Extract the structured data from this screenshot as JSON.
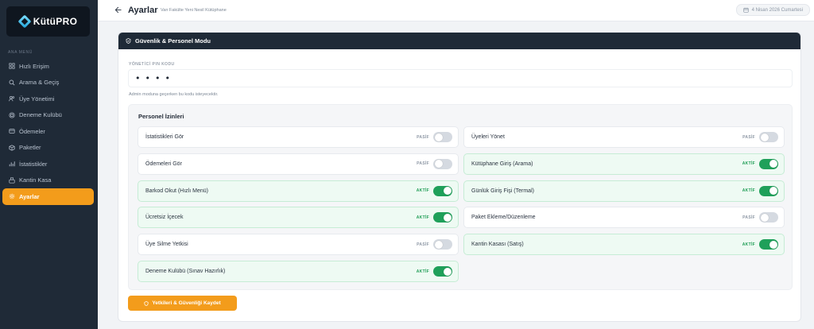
{
  "app": {
    "logo_text": "KütüPRO"
  },
  "sidebar": {
    "caption": "ANA MENÜ",
    "items": [
      {
        "label": "Hızlı Erişim",
        "icon": "grid-icon",
        "active": false
      },
      {
        "label": "Arama & Geçiş",
        "icon": "search-icon",
        "active": false
      },
      {
        "label": "Üye Yönetimi",
        "icon": "users-icon",
        "active": false
      },
      {
        "label": "Deneme Kulübü",
        "icon": "target-icon",
        "active": false
      },
      {
        "label": "Ödemeler",
        "icon": "wallet-icon",
        "active": false
      },
      {
        "label": "Paketler",
        "icon": "box-icon",
        "active": false
      },
      {
        "label": "İstatistikler",
        "icon": "chart-icon",
        "active": false
      },
      {
        "label": "Kantin Kasa",
        "icon": "register-icon",
        "active": false
      },
      {
        "label": "Ayarlar",
        "icon": "gear-icon",
        "active": true
      }
    ]
  },
  "header": {
    "title": "Ayarlar",
    "subtitle": "Van Fakülte Yeni Nesil Kütüphane",
    "date": "4 Nisan 2026 Cumartesi"
  },
  "card": {
    "title": "Güvenlik & Personel Modu",
    "pin_label": "YÖNETİCİ PIN KODU",
    "pin_value": "••••",
    "pin_hint": "Admin moduna geçerken bu kodu isteyecektir."
  },
  "permissions": {
    "title": "Personel İzinleri",
    "active_label": "AKTİF",
    "passive_label": "PASİF",
    "items": [
      {
        "label": "İstatistikleri Gör",
        "enabled": false
      },
      {
        "label": "Üyeleri Yönet",
        "enabled": false
      },
      {
        "label": "Ödemeleri Gör",
        "enabled": false
      },
      {
        "label": "Kütüphane Giriş (Arama)",
        "enabled": true
      },
      {
        "label": "Barkod Okut (Hızlı Menü)",
        "enabled": true
      },
      {
        "label": "Günlük Giriş Fişi (Termal)",
        "enabled": true
      },
      {
        "label": "Ücretsiz İçecek",
        "enabled": true
      },
      {
        "label": "Paket Ekleme/Düzenleme",
        "enabled": false
      },
      {
        "label": "Üye Silme Yetkisi",
        "enabled": false
      },
      {
        "label": "Kantin Kasası (Satış)",
        "enabled": true
      },
      {
        "label": "Deneme Kulübü (Sınav Hazırlık)",
        "enabled": true
      }
    ]
  },
  "actions": {
    "save_label": "Yetkileri & Güvenliği Kaydet"
  },
  "colors": {
    "accent": "#f39c1b",
    "sidebar_bg": "#1f2a37",
    "active_green": "#1fa05a"
  }
}
